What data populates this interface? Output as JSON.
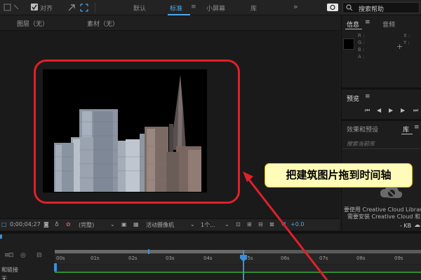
{
  "topbar": {
    "snap_label": "对齐",
    "workspaces": [
      "默认",
      "标准",
      "小屏幕",
      "库"
    ],
    "search_placeholder": "搜索帮助"
  },
  "comp_header": {
    "layer_label": "图层（无）",
    "footage_label": "素材（无）"
  },
  "viewer_toolbar": {
    "timecode": "0;00;04;27",
    "resolution": "(完整)",
    "camera": "活动摄像机",
    "views": "1个...",
    "exposure": "+0.0"
  },
  "info_panel": {
    "tab_info": "信息",
    "tab_audio": "音频",
    "channels": [
      "R :",
      "G :",
      "B :",
      "A :"
    ],
    "coords": [
      "X :",
      "Y :"
    ]
  },
  "preview_panel": {
    "title": "预览"
  },
  "effects_panel": {
    "title": "效果和预设",
    "tab_library": "库",
    "search_placeholder": "搜索当前库"
  },
  "library_panel": {
    "message_1": "要使用 Creative Cloud Librar",
    "message_2": "需要安装 Creative Cloud 和",
    "size_unit": "- KB"
  },
  "timeline": {
    "labels": [
      "00s",
      "01s",
      "02s",
      "03s",
      "04s",
      "05s",
      "06s",
      "07s",
      "08s",
      "09s"
    ],
    "left_text_1": "和链接",
    "left_text_2": "无"
  },
  "callout": {
    "text": "把建筑图片拖到时间轴"
  },
  "colors": {
    "accent_blue": "#4ea8e8",
    "annotation_red": "#e0202a",
    "callout_bg": "#fffbb8"
  }
}
